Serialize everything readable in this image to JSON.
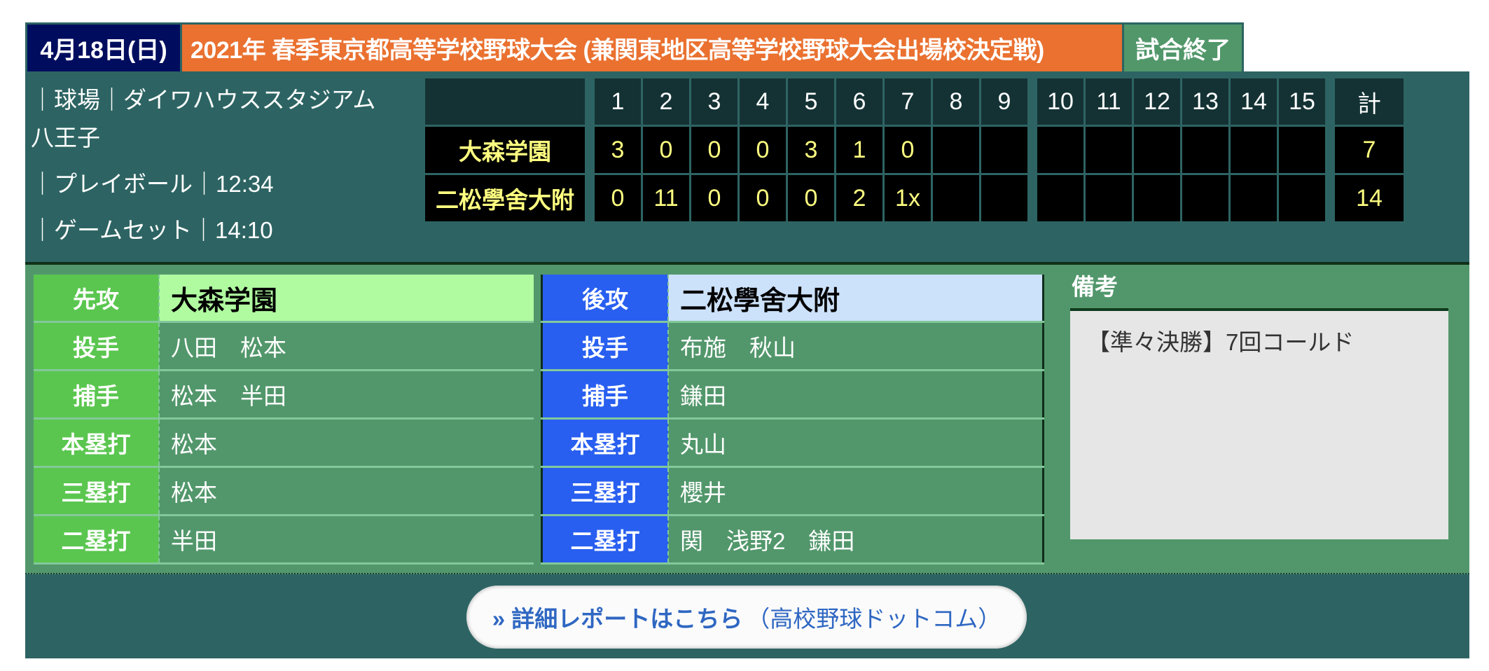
{
  "header": {
    "date": "4月18日(日)",
    "title": "2021年 春季東京都高等学校野球大会 (兼関東地区高等学校野球大会出場校決定戦)",
    "status": "試合終了"
  },
  "info": {
    "stadium_label": "｜球場｜ダイワハウススタジアム",
    "stadium_cont": "八王子",
    "playball": "｜プレイボール｜12:34",
    "gameset": "｜ゲームセット｜14:10"
  },
  "scoreboard": {
    "innings": [
      "1",
      "2",
      "3",
      "4",
      "5",
      "6",
      "7",
      "8",
      "9",
      "10",
      "11",
      "12",
      "13",
      "14",
      "15"
    ],
    "total_label": "計",
    "teams": [
      {
        "name": "大森学園",
        "scores": [
          "3",
          "0",
          "0",
          "0",
          "3",
          "1",
          "0",
          "",
          "",
          "",
          "",
          "",
          "",
          "",
          ""
        ],
        "total": "7"
      },
      {
        "name": "二松學舍大附",
        "scores": [
          "0",
          "11",
          "0",
          "0",
          "0",
          "2",
          "1x",
          "",
          "",
          "",
          "",
          "",
          "",
          "",
          ""
        ],
        "total": "14"
      }
    ]
  },
  "lineup": {
    "home": {
      "side_label": "先攻",
      "team": "大森学園",
      "rows": [
        {
          "label": "投手",
          "value": "八田　松本"
        },
        {
          "label": "捕手",
          "value": "松本　半田"
        },
        {
          "label": "本塁打",
          "value": "松本"
        },
        {
          "label": "三塁打",
          "value": "松本"
        },
        {
          "label": "二塁打",
          "value": "半田"
        }
      ]
    },
    "away": {
      "side_label": "後攻",
      "team": "二松學舍大附",
      "rows": [
        {
          "label": "投手",
          "value": "布施　秋山"
        },
        {
          "label": "捕手",
          "value": "鎌田"
        },
        {
          "label": "本塁打",
          "value": "丸山"
        },
        {
          "label": "三塁打",
          "value": "櫻井"
        },
        {
          "label": "二塁打",
          "value": "関　浅野2　鎌田"
        }
      ]
    }
  },
  "notes": {
    "title": "備考",
    "body": "【準々決勝】7回コールド"
  },
  "footer": {
    "link_prefix": "» 詳細レポートはこちら",
    "link_suffix": "（高校野球ドットコム）"
  },
  "colors": {
    "date_bg": "#000d5e",
    "title_bg": "#ea7130",
    "status_bg": "#51976a",
    "panel_bg": "#2d6463",
    "home_accent": "#5ac64f",
    "away_accent": "#285ff0",
    "score_text": "#ffff80",
    "link": "#2f67c2"
  }
}
